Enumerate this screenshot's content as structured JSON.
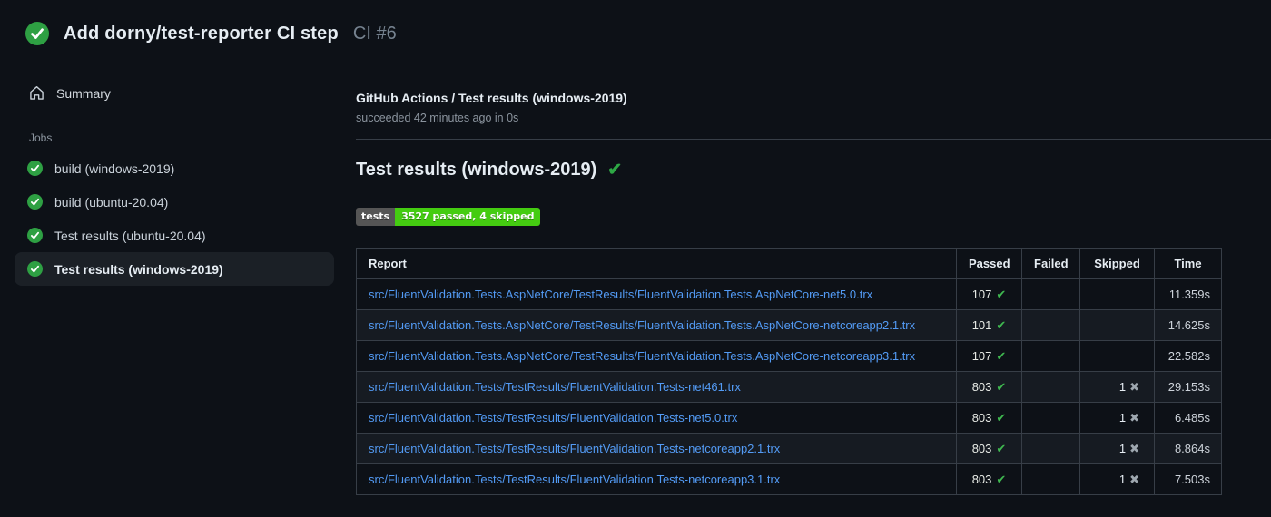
{
  "run_header": {
    "title": "Add dorny/test-reporter CI step",
    "run_ref": "CI #6",
    "status": "success"
  },
  "sidebar": {
    "summary_label": "Summary",
    "jobs_heading": "Jobs",
    "jobs": [
      {
        "label": "build (windows-2019)",
        "status": "success",
        "selected": false
      },
      {
        "label": "build (ubuntu-20.04)",
        "status": "success",
        "selected": false
      },
      {
        "label": "Test results (ubuntu-20.04)",
        "status": "success",
        "selected": false
      },
      {
        "label": "Test results (windows-2019)",
        "status": "success",
        "selected": true
      }
    ]
  },
  "main": {
    "check_name": "GitHub Actions / Test results (windows-2019)",
    "status_line": "succeeded 42 minutes ago in 0s",
    "section_heading": "Test results (windows-2019)",
    "badge": {
      "label": "tests",
      "value": "3527 passed, 4 skipped"
    },
    "table": {
      "headers": [
        "Report",
        "Passed",
        "Failed",
        "Skipped",
        "Time"
      ],
      "rows": [
        {
          "report": "src/FluentValidation.Tests.AspNetCore/TestResults/FluentValidation.Tests.AspNetCore-net5.0.trx",
          "passed": "107",
          "failed": "",
          "skipped": "",
          "time": "11.359s"
        },
        {
          "report": "src/FluentValidation.Tests.AspNetCore/TestResults/FluentValidation.Tests.AspNetCore-netcoreapp2.1.trx",
          "passed": "101",
          "failed": "",
          "skipped": "",
          "time": "14.625s"
        },
        {
          "report": "src/FluentValidation.Tests.AspNetCore/TestResults/FluentValidation.Tests.AspNetCore-netcoreapp3.1.trx",
          "passed": "107",
          "failed": "",
          "skipped": "",
          "time": "22.582s"
        },
        {
          "report": "src/FluentValidation.Tests/TestResults/FluentValidation.Tests-net461.trx",
          "passed": "803",
          "failed": "",
          "skipped": "1",
          "time": "29.153s"
        },
        {
          "report": "src/FluentValidation.Tests/TestResults/FluentValidation.Tests-net5.0.trx",
          "passed": "803",
          "failed": "",
          "skipped": "1",
          "time": "6.485s"
        },
        {
          "report": "src/FluentValidation.Tests/TestResults/FluentValidation.Tests-netcoreapp2.1.trx",
          "passed": "803",
          "failed": "",
          "skipped": "1",
          "time": "8.864s"
        },
        {
          "report": "src/FluentValidation.Tests/TestResults/FluentValidation.Tests-netcoreapp3.1.trx",
          "passed": "803",
          "failed": "",
          "skipped": "1",
          "time": "7.503s"
        }
      ]
    }
  },
  "icons": {
    "pass_glyph": "✔",
    "skip_glyph": "✖",
    "heading_check_glyph": "✔"
  },
  "colors": {
    "page_bg": "#0d1117",
    "accent_green": "#2ea043",
    "pass_check_green": "#3fb950",
    "link_blue": "#539bf5",
    "badge_label_bg": "#555555",
    "badge_value_bg": "#44cc11",
    "border": "#373e47",
    "muted_text": "#8b949e"
  }
}
